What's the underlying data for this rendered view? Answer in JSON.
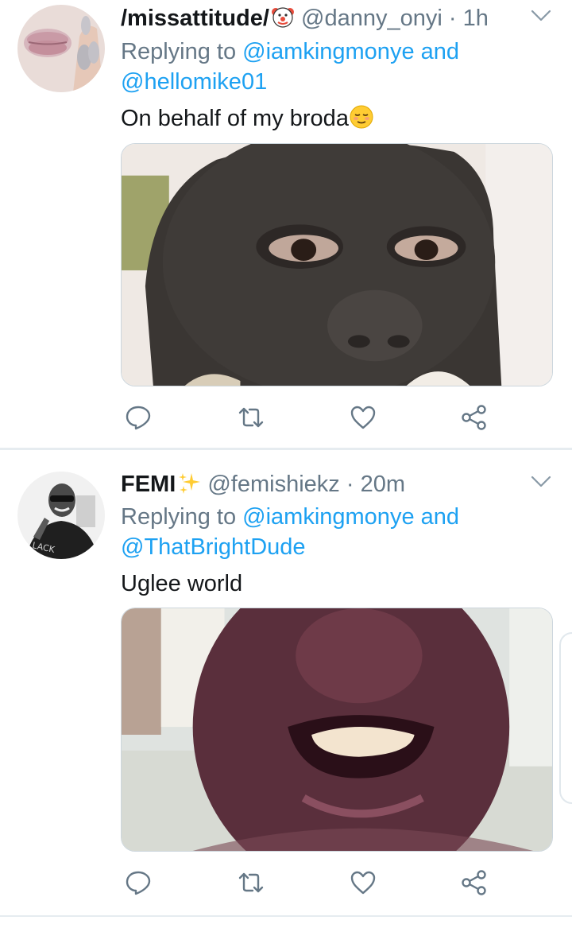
{
  "tweets": [
    {
      "display_name": "/missattitude/",
      "name_emoji": "clown-face-emoji",
      "handle": "@danny_onyi",
      "separator": "·",
      "time": "1h",
      "reply_prefix": "Replying to",
      "reply_user_1": "@iamkingmonye",
      "reply_and": "and",
      "reply_user_2": "@hellomike01",
      "text": "On behalf of my broda",
      "text_emoji": "relieved-face-emoji",
      "media_alt": "photo-close-up-face"
    },
    {
      "display_name": "FEMI",
      "name_emoji": "sparkles-emoji",
      "handle": "@femishiekz",
      "separator": "·",
      "time": "20m",
      "reply_prefix": "Replying to",
      "reply_user_1": "@iamkingmonye",
      "reply_and": "and",
      "reply_user_2": "@ThatBrightDude",
      "text": "Uglee world",
      "media_alt": "photo-smiling-face"
    }
  ],
  "colors": {
    "link": "#1da1f2",
    "secondary": "#657786",
    "primary_text": "#14171a",
    "divider": "#e6ecf0"
  },
  "icons": {
    "reply": "reply-icon",
    "retweet": "retweet-icon",
    "like": "heart-icon",
    "share": "share-icon",
    "menu": "chevron-down-icon"
  }
}
